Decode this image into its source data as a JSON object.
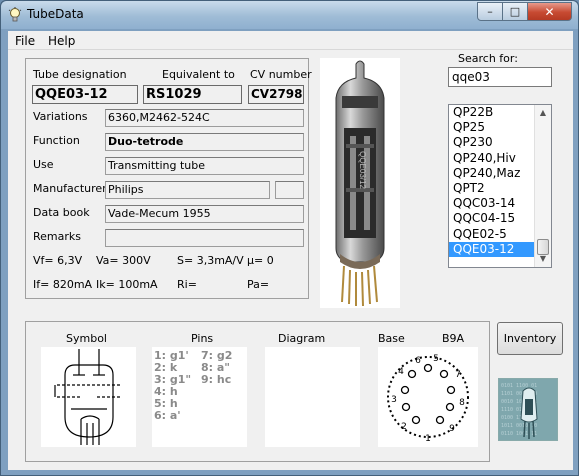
{
  "window": {
    "title": "TubeData",
    "min_glyph": "–",
    "max_glyph": "□",
    "close_glyph": "✕"
  },
  "menu": {
    "file": "File",
    "help": "Help"
  },
  "header": {
    "designation_label": "Tube designation",
    "equivalent_label": "Equivalent to",
    "cv_label": "CV number",
    "designation": "QQE03-12",
    "equivalent": "RS1029",
    "cv": "CV2798"
  },
  "fields": {
    "variations_label": "Variations",
    "variations": "6360,M2462-524C",
    "function_label": "Function",
    "function": "Duo-tetrode",
    "use_label": "Use",
    "use": "Transmitting tube",
    "manufacturer_label": "Manufacturer",
    "manufacturer": "Philips",
    "databook_label": "Data book",
    "databook": "Vade-Mecum 1955",
    "remarks_label": "Remarks",
    "remarks": ""
  },
  "specs": {
    "vf": "Vf= 6,3V",
    "va": "Va=  300V",
    "s": "S= 3,3mA/V",
    "mu": "µ=    0",
    "if": "If= 820mA",
    "ik": "Ik=   100mA",
    "ri": "Ri=",
    "pa": "Pa="
  },
  "search": {
    "label": "Search for:",
    "value": "qqe03",
    "results": [
      "QP22B",
      "QP25",
      "QP230",
      "QP240,Hiv",
      "QP240,Maz",
      "QPT2",
      "QQC03-14",
      "QQC04-15",
      "QQE02-5",
      "QQE03-12"
    ],
    "selected_index": 9
  },
  "bottom": {
    "symbol_label": "Symbol",
    "pins_label": "Pins",
    "diagram_label": "Diagram",
    "base_label": "Base",
    "base_type": "B9A",
    "pins_left": [
      "1: g1'",
      "2: k",
      "3: g1\"",
      "4: h",
      "5: h",
      "6: a'"
    ],
    "pins_right": [
      "7: g2",
      "8: a\"",
      "9: hc"
    ],
    "base_pin_numbers": [
      "1",
      "2",
      "3",
      "4",
      "5",
      "6",
      "7",
      "8",
      "9"
    ]
  },
  "inventory_label": "Inventory",
  "icons": {
    "app": "lightbulb-icon",
    "scroll_up": "chevron-up-icon",
    "scroll_down": "chevron-down-icon"
  },
  "colors": {
    "selection": "#3399ff",
    "close_button": "#c74a32",
    "titlebar": "#9fbcd6"
  }
}
